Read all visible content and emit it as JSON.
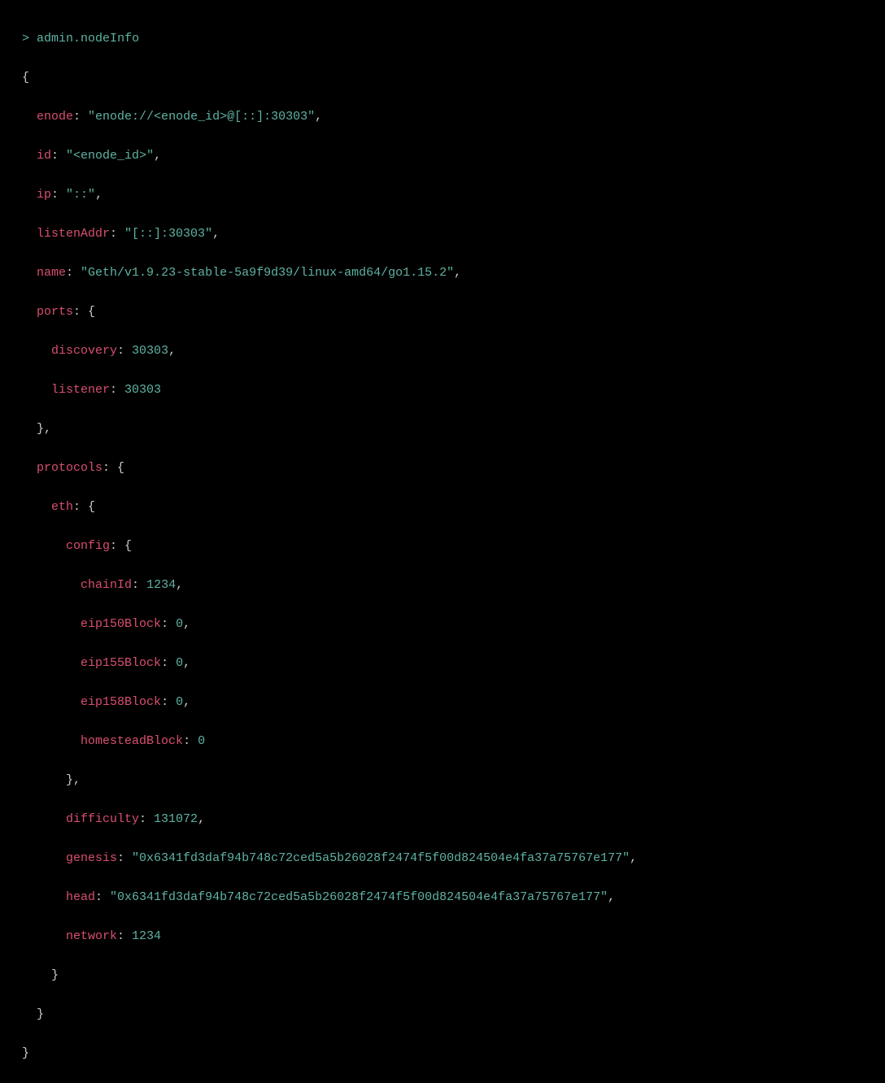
{
  "terminal": {
    "prompt": ">",
    "command": "admin.nodeInfo",
    "open_brace": "{",
    "close_brace": "}",
    "open_brace_comma": "},",
    "colon_space": ": ",
    "comma": ",",
    "keys": {
      "enode": "enode",
      "id": "id",
      "ip": "ip",
      "listenAddr": "listenAddr",
      "name": "name",
      "ports": "ports",
      "discovery": "discovery",
      "listener": "listener",
      "protocols": "protocols",
      "eth": "eth",
      "config": "config",
      "chainId": "chainId",
      "eip150Block": "eip150Block",
      "eip155Block": "eip155Block",
      "eip158Block": "eip158Block",
      "homesteadBlock": "homesteadBlock",
      "difficulty": "difficulty",
      "genesis": "genesis",
      "head": "head",
      "network": "network"
    },
    "values": {
      "enode": "\"enode://<enode_id>@[::]:30303\"",
      "id": "\"<enode_id>\"",
      "ip": "\"::\"",
      "listenAddr": "\"[::]:30303\"",
      "name": "\"Geth/v1.9.23-stable-5a9f9d39/linux-amd64/go1.15.2\"",
      "discovery": "30303",
      "listener": "30303",
      "chainId": "1234",
      "eip150Block": "0",
      "eip155Block": "0",
      "eip158Block": "0",
      "homesteadBlock": "0",
      "difficulty": "131072",
      "genesis": "\"0x6341fd3daf94b748c72ced5a5b26028f2474f5f00d824504e4fa37a75767e177\"",
      "head": "\"0x6341fd3daf94b748c72ced5a5b26028f2474f5f00d824504e4fa37a75767e177\"",
      "network": "1234"
    }
  }
}
